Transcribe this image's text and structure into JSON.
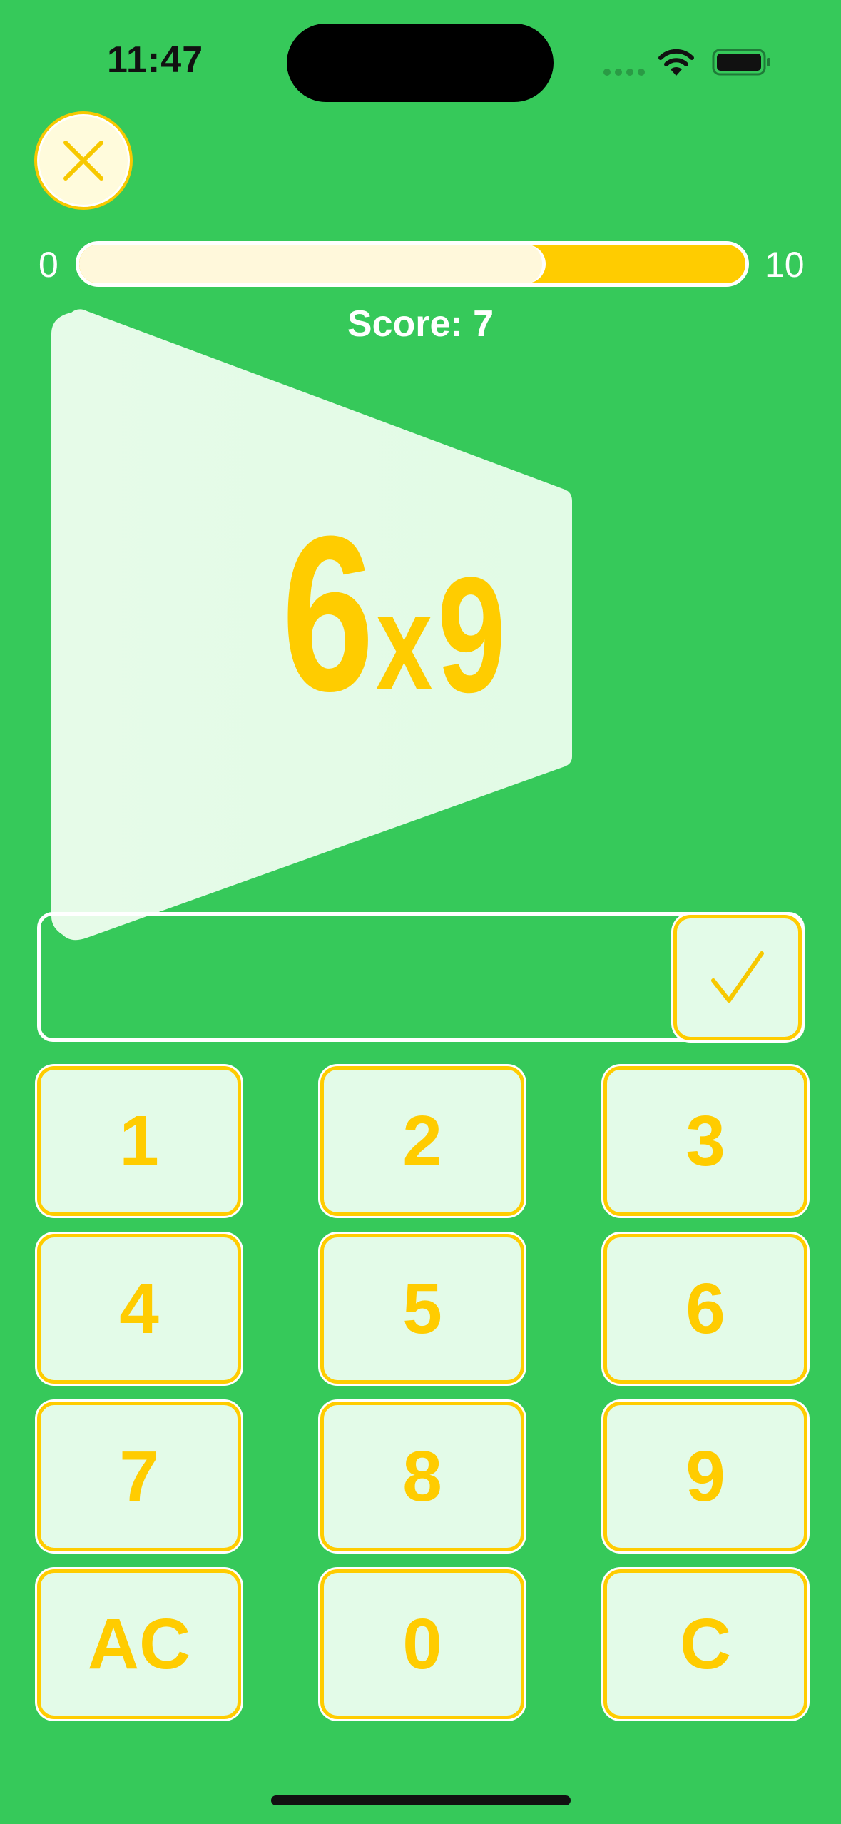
{
  "status_bar": {
    "time": "11:47"
  },
  "progress": {
    "min_label": "0",
    "max_label": "10",
    "value": 7,
    "max": 10
  },
  "score_text": "Score: 7",
  "question": {
    "a": "6",
    "operator": "x",
    "b": "9"
  },
  "answer": {
    "value": ""
  },
  "keypad": {
    "keys": [
      "1",
      "2",
      "3",
      "4",
      "5",
      "6",
      "7",
      "8",
      "9",
      "AC",
      "0",
      "C"
    ]
  },
  "colors": {
    "background": "#36c95a",
    "accent": "#ffcc00",
    "card": "#e3fbe8"
  },
  "icons": {
    "close": "close-x-icon",
    "submit": "checkmark-icon"
  }
}
